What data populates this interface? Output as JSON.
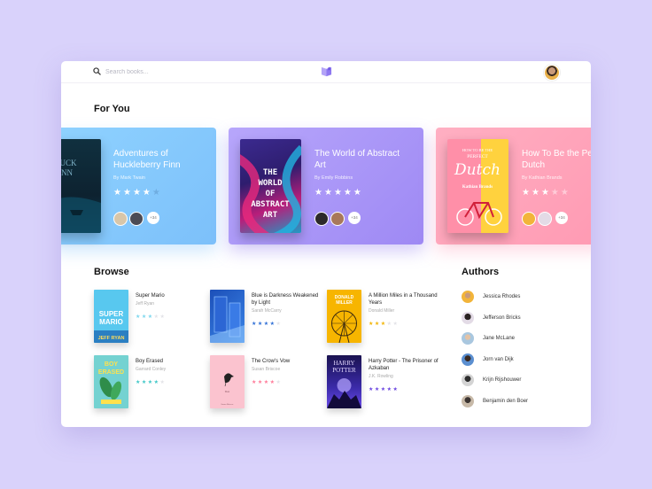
{
  "search": {
    "placeholder": "Search books..."
  },
  "sections": {
    "for_you": "For You",
    "browse": "Browse",
    "authors": "Authors"
  },
  "featured": [
    {
      "title": "Adventures of Huckleberry Finn",
      "author": "By Mark Twain",
      "rating": 4,
      "more_readers": "+34",
      "cover_text": "HUCK\nFINN",
      "color": "#7cc0fa"
    },
    {
      "title": "The World of Abstract Art",
      "author": "By Emily Robbins",
      "rating": 5,
      "more_readers": "+34",
      "cover_text": "THE WORLD OF ABSTRACT ART",
      "color": "#9e89f4"
    },
    {
      "title": "How To Be the Perfect Dutch",
      "author": "By Kathian Brands",
      "rating": 3,
      "more_readers": "+34",
      "cover_text": "How to be the Perfect Dutch",
      "cover_sub": "Kathian Brands",
      "color": "#ff9ab3"
    }
  ],
  "browse": [
    {
      "title": "Super Mario",
      "author": "Jeff Ryan",
      "rating": 3,
      "star_color": "#7dd7ee",
      "cover_text": "SUPER MARIO",
      "cover_sub": "JEFF RYAN"
    },
    {
      "title": "Blue is Darkness Weakened by Light",
      "author": "Sarah McCarry",
      "rating": 4,
      "star_color": "#2f6fd6",
      "cover_text": ""
    },
    {
      "title": "A Million Miles in a Thousand Years",
      "author": "Donald Miller",
      "rating": 3,
      "star_color": "#f2b400",
      "cover_text": "DONALD MILLER"
    },
    {
      "title": "Boy Erased",
      "author": "Garrard Conley",
      "rating": 4,
      "star_color": "#3fc7c7",
      "cover_text": "BOY ERASED"
    },
    {
      "title": "The Crow's Vow",
      "author": "Susan Briscoe",
      "rating": 4,
      "star_color": "#ff7a99",
      "cover_text": ""
    },
    {
      "title": "Harry Potter - The Prisoner of Azkaban",
      "author": "J.K. Rowling",
      "rating": 5,
      "star_color": "#6b46e0",
      "cover_text": "HARRY POTTER"
    }
  ],
  "authors": [
    {
      "name": "Jessica Rhodes",
      "avatar_color": "#f2b43a"
    },
    {
      "name": "Jefferson Bricks",
      "avatar_color": "#e3dbe6"
    },
    {
      "name": "Jane McLane",
      "avatar_color": "#a9c7df"
    },
    {
      "name": "Jorn van Dijk",
      "avatar_color": "#5b8fd0"
    },
    {
      "name": "Krijn Rijshouwer",
      "avatar_color": "#d4d4d4"
    },
    {
      "name": "Benjamin den Boer",
      "avatar_color": "#c7b9a8"
    }
  ]
}
